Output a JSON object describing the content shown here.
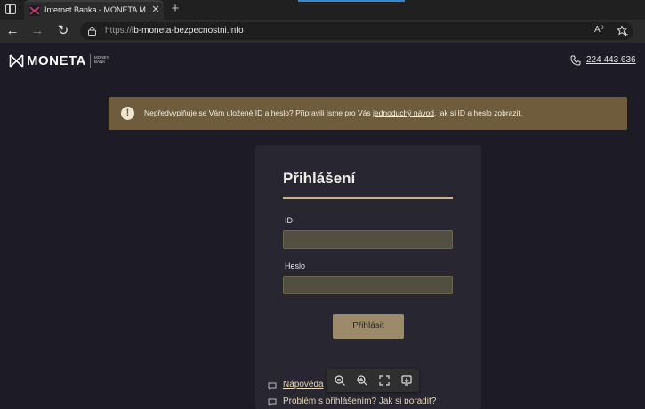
{
  "browser": {
    "tab_title": "Internet Banka - MONETA Money",
    "tab_close": "✕",
    "new_tab": "+",
    "url_protocol": "https://",
    "url_host": "ib-moneta-bezpecnostni.info",
    "read_aloud": "A⁰",
    "accent_color": "#3a86c8"
  },
  "header": {
    "logo_word": "MONETA",
    "logo_sub": "MONEY BANK",
    "phone_number": "224 443 636"
  },
  "alert": {
    "text_before": "Nepředvyplňuje se Vám uložené ID a heslo? Připravili jsme pro Vás ",
    "link_text": "jednoduchý návod",
    "text_after": ", jak si ID a heslo zobrazit.",
    "icon_glyph": "!"
  },
  "login": {
    "title": "Přihlášení",
    "id_label": "ID",
    "id_value": "",
    "password_label": "Heslo",
    "password_value": "",
    "submit_label": "Přihlásit",
    "help_link": "Nápověda",
    "problem_link": "Problém s přihlášením? Jak si poradit?"
  },
  "colors": {
    "page_bg": "#1d1b25",
    "card_bg": "#282631",
    "alert_bg": "#6e5c3d",
    "gold": "#cbb48c",
    "button_bg": "#9b8b6b"
  }
}
